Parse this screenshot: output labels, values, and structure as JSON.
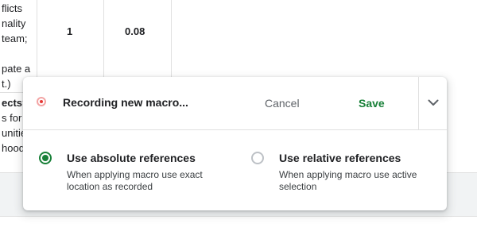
{
  "sheet": {
    "text_lines": [
      "flicts",
      "nality",
      "team;",
      "pate a",
      "t.)",
      "ects?",
      "s for",
      "unitie",
      "hood"
    ],
    "row_values": [
      "1",
      "0.08"
    ]
  },
  "macro_panel": {
    "recording_label": "Recording new macro...",
    "cancel_label": "Cancel",
    "save_label": "Save",
    "options": [
      {
        "title": "Use absolute references",
        "description": "When applying macro use exact location as recorded",
        "selected": true
      },
      {
        "title": "Use relative references",
        "description": "When applying macro use active selection",
        "selected": false
      }
    ]
  },
  "colors": {
    "accent_green": "#188038",
    "record_red": "#e53935",
    "muted_text": "#5f6368"
  },
  "icons": [
    "record-icon",
    "chevron-down-icon",
    "radio-selected-icon",
    "radio-unselected-icon"
  ]
}
